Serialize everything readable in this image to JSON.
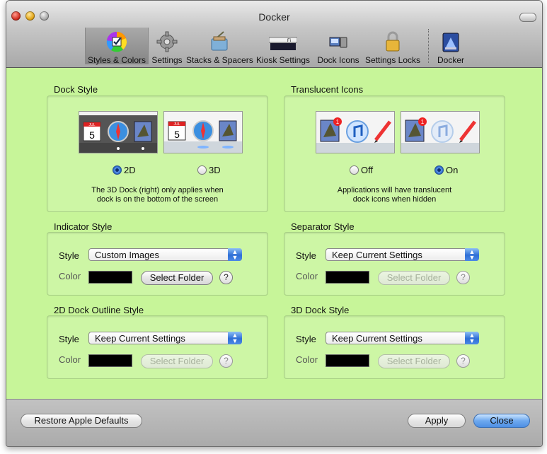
{
  "window": {
    "title": "Docker"
  },
  "toolbar": {
    "items": [
      {
        "label": "Styles & Colors",
        "icon": "color-wheel-icon"
      },
      {
        "label": "Settings",
        "icon": "gear-icon"
      },
      {
        "label": "Stacks & Spacers",
        "icon": "stacks-icon"
      },
      {
        "label": "Kiosk Settings",
        "icon": "kiosk-icon"
      },
      {
        "label": "Dock Icons",
        "icon": "dock-icons-icon"
      },
      {
        "label": "Settings Locks",
        "icon": "lock-icon"
      },
      {
        "label": "Docker",
        "icon": "docker-app-icon"
      }
    ]
  },
  "dock_style": {
    "title": "Dock Style",
    "options": [
      {
        "label": "2D",
        "selected": true
      },
      {
        "label": "3D",
        "selected": false
      }
    ],
    "note_line1": "The 3D Dock (right) only applies when",
    "note_line2": "dock is on the bottom of the screen"
  },
  "translucent_icons": {
    "title": "Translucent Icons",
    "options": [
      {
        "label": "Off",
        "selected": false
      },
      {
        "label": "On",
        "selected": true
      }
    ],
    "note_line1": "Applications will have translucent",
    "note_line2": "dock icons when hidden"
  },
  "indicator_style": {
    "title": "Indicator Style",
    "style_label": "Style",
    "style_value": "Custom Images",
    "color_label": "Color",
    "select_folder": "Select Folder",
    "help": "?"
  },
  "separator_style": {
    "title": "Separator Style",
    "style_label": "Style",
    "style_value": "Keep Current Settings",
    "color_label": "Color",
    "select_folder": "Select Folder",
    "help": "?"
  },
  "outline_2d_style": {
    "title": "2D Dock Outline Style",
    "style_label": "Style",
    "style_value": "Keep Current Settings",
    "color_label": "Color",
    "select_folder": "Select Folder",
    "help": "?"
  },
  "dock_3d_style": {
    "title": "3D Dock Style",
    "style_label": "Style",
    "style_value": "Keep Current Settings",
    "color_label": "Color",
    "select_folder": "Select Folder",
    "help": "?"
  },
  "thumb_text": {
    "calendar_day": "5",
    "calendar_month": "JUL",
    "mail_badge": "1"
  },
  "footer": {
    "restore": "Restore Apple Defaults",
    "apply": "Apply",
    "close": "Close"
  },
  "colors": {
    "content_bg": "#c7f599",
    "swatch": "#000000",
    "accent": "#2f6fd6"
  }
}
